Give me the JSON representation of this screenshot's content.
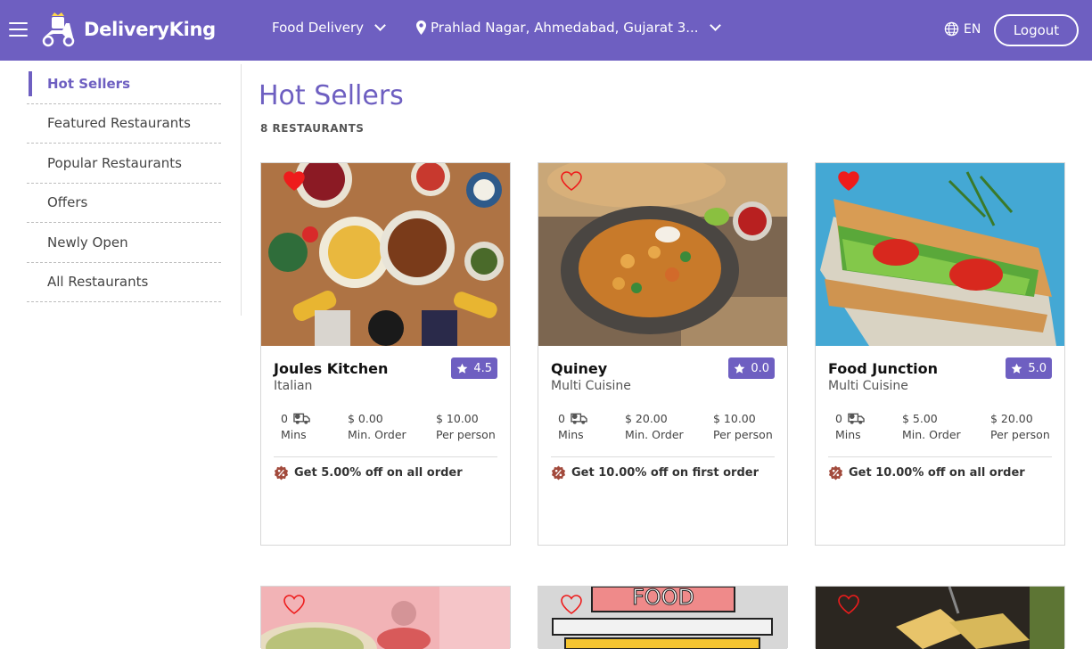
{
  "header": {
    "brand": "DeliveryKing",
    "service": "Food Delivery",
    "location": "Prahlad Nagar, Ahmedabad, Gujarat 3...",
    "language": "EN",
    "logout_label": "Logout",
    "bg_color": "#6e5fc1"
  },
  "sidebar": {
    "items": [
      {
        "label": "Hot Sellers",
        "active": true
      },
      {
        "label": "Featured Restaurants"
      },
      {
        "label": "Popular Restaurants"
      },
      {
        "label": "Offers"
      },
      {
        "label": "Newly Open"
      },
      {
        "label": "All Restaurants"
      }
    ]
  },
  "main": {
    "title": "Hot Sellers",
    "count": "8 RESTAURANTS"
  },
  "restaurants": [
    {
      "name": "Joules Kitchen",
      "cuisine": "Italian",
      "rating": "4.5",
      "time": "0",
      "time_unit": "Mins",
      "min_order": "$ 0.00",
      "min_order_label": "Min. Order",
      "per_person": "$ 10.00",
      "per_person_label": "Per person",
      "offer": "Get 5.00% off on all order",
      "favorite": true
    },
    {
      "name": "Quiney",
      "cuisine": "Multi Cuisine",
      "rating": "0.0",
      "time": "0",
      "time_unit": "Mins",
      "min_order": "$ 20.00",
      "min_order_label": "Min. Order",
      "per_person": "$ 10.00",
      "per_person_label": "Per person",
      "offer": "Get 10.00% off on first order",
      "favorite": false
    },
    {
      "name": "Food Junction",
      "cuisine": "Multi Cuisine",
      "rating": "5.0",
      "time": "0",
      "time_unit": "Mins",
      "min_order": "$ 5.00",
      "min_order_label": "Min. Order",
      "per_person": "$ 20.00",
      "per_person_label": "Per person",
      "offer": "Get 10.00% off on all order",
      "favorite": true
    },
    {
      "favorite": false
    },
    {
      "favorite": false,
      "image_text": "FOOD"
    },
    {
      "favorite": false
    }
  ],
  "colors": {
    "accent": "#6e5fc1",
    "heart": "#ee1c1c"
  }
}
